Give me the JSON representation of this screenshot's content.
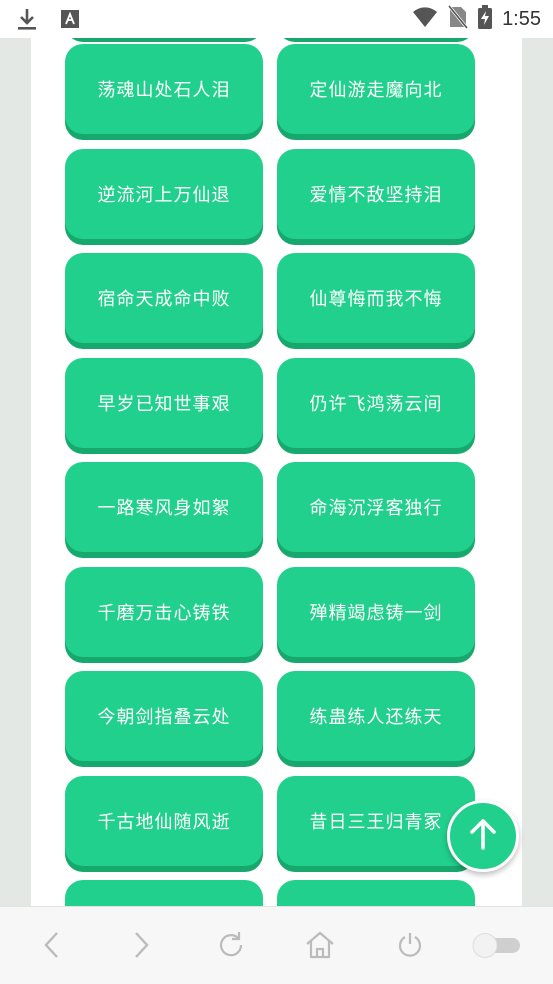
{
  "status_bar": {
    "time": "1:55",
    "icons": [
      "download-icon",
      "text-a-icon",
      "wifi-icon",
      "no-sim-icon",
      "battery-charging-icon"
    ]
  },
  "grid": {
    "rows": [
      [
        "荡魂山处石人泪",
        "定仙游走魔向北"
      ],
      [
        "逆流河上万仙退",
        "爱情不敌坚持泪"
      ],
      [
        "宿命天成命中败",
        "仙尊悔而我不悔"
      ],
      [
        "早岁已知世事艰",
        "仍许飞鸿荡云间"
      ],
      [
        "一路寒风身如絮",
        "命海沉浮客独行"
      ],
      [
        "千磨万击心铸铁",
        "殚精竭虑铸一剑"
      ],
      [
        "今朝剑指叠云处",
        "练蛊练人还练天"
      ],
      [
        "千古地仙随风逝",
        "昔日三王归青冢"
      ]
    ]
  },
  "fab": {
    "icon": "arrow-up-icon"
  },
  "nav": {
    "icons": [
      "back-icon",
      "forward-icon",
      "refresh-icon",
      "home-icon",
      "power-icon",
      "toggle-switch"
    ],
    "toggle_on": false
  },
  "colors": {
    "accent": "#21d08c",
    "accent_shadow": "#17a86d"
  }
}
